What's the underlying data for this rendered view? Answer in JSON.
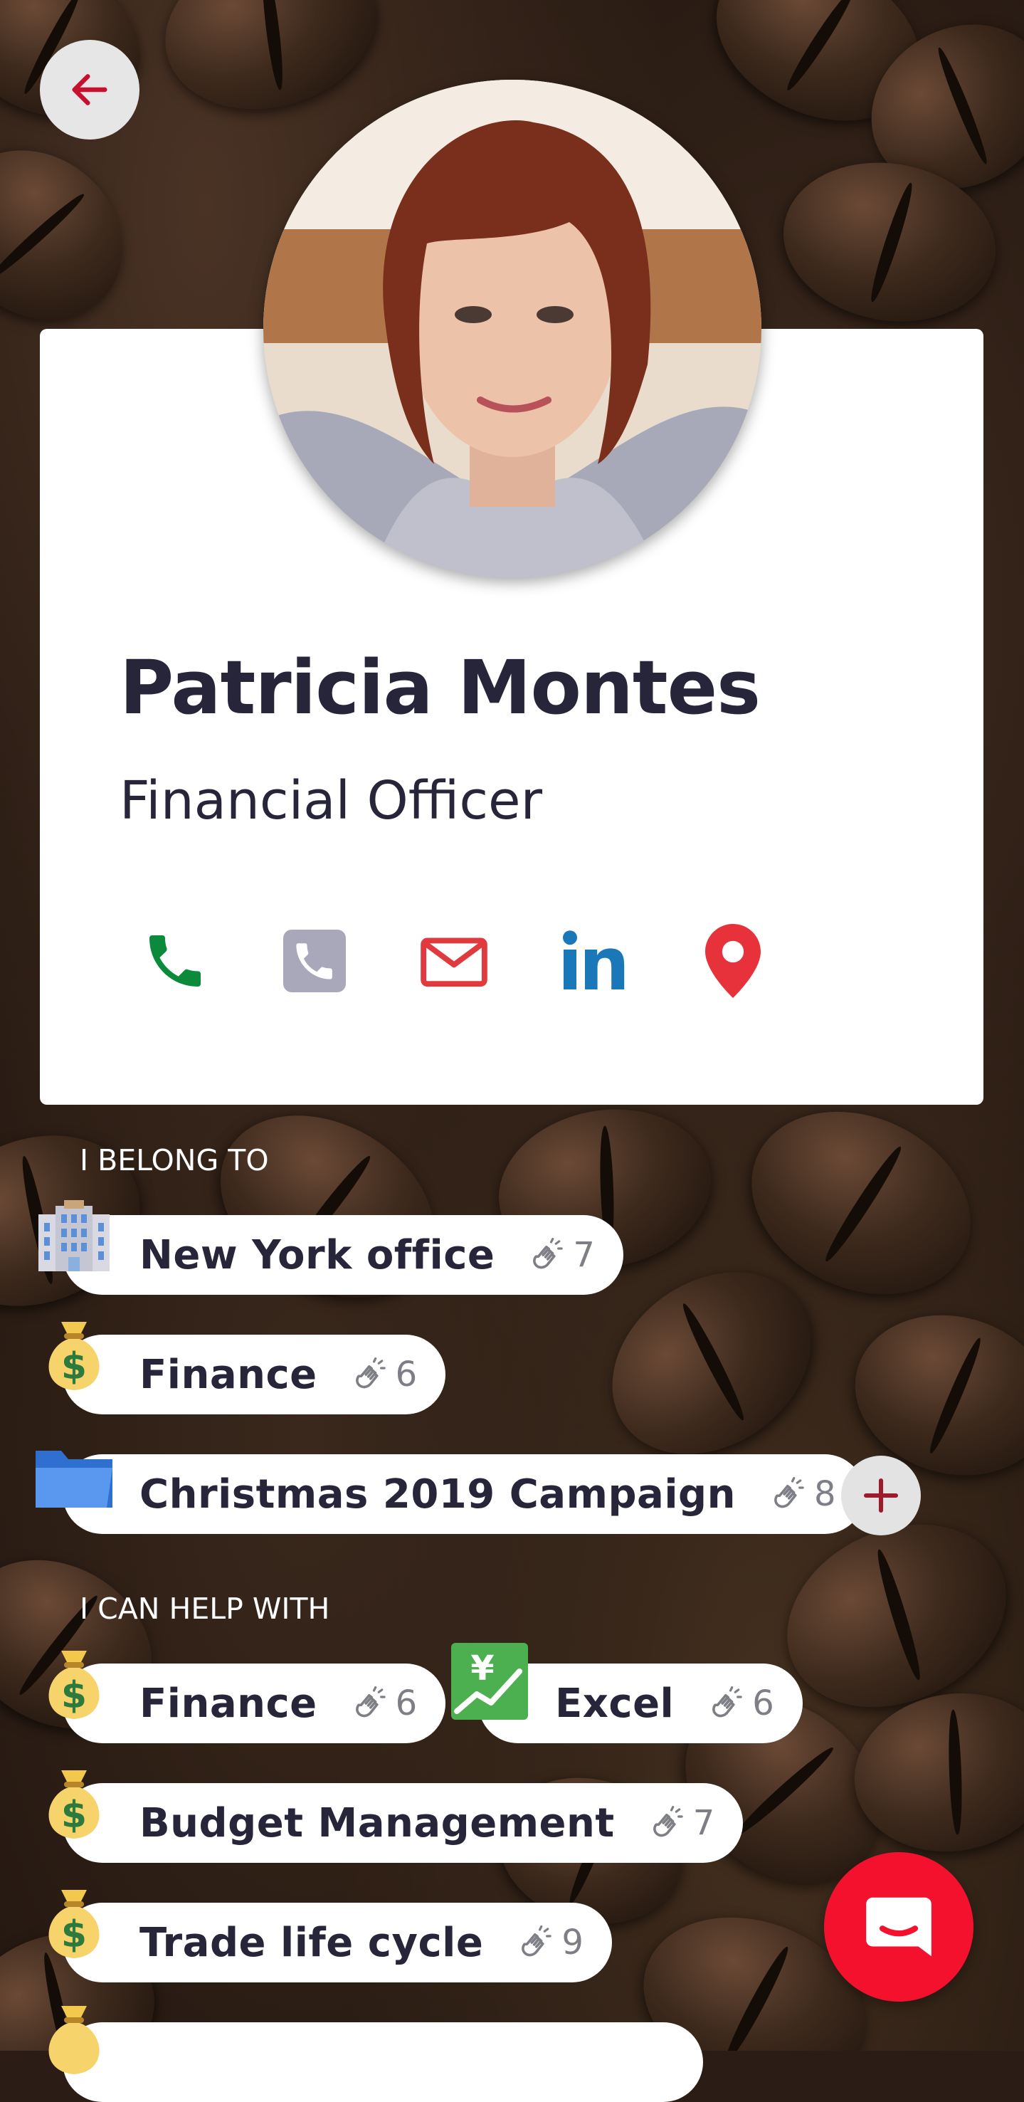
{
  "profile": {
    "name": "Patricia Montes",
    "title": "Financial Officer"
  },
  "contacts": [
    {
      "icon": "phone-icon",
      "color": "#0a8a3a"
    },
    {
      "icon": "landline-icon",
      "color": "#a9a8bb"
    },
    {
      "icon": "email-icon",
      "color": "#e03a3e"
    },
    {
      "icon": "linkedin-icon",
      "color": "#1a78b8"
    },
    {
      "icon": "location-pin-icon",
      "color": "#e8323b"
    }
  ],
  "sections": {
    "belong_to": "I BELONG TO",
    "help_with": "I CAN HELP WITH"
  },
  "groups": [
    {
      "label": "New York office",
      "count": "7",
      "icon": "office-building-icon"
    },
    {
      "label": "Finance",
      "count": "6",
      "icon": "money-bag-icon"
    },
    {
      "label": "Christmas 2019 Campaign",
      "count": "8",
      "icon": "folder-icon"
    }
  ],
  "skills": [
    {
      "label": "Finance",
      "count": "6",
      "icon": "money-bag-icon"
    },
    {
      "label": "Excel",
      "count": "6",
      "icon": "yen-chart-icon"
    },
    {
      "label": "Budget Management",
      "count": "7",
      "icon": "money-bag-icon"
    },
    {
      "label": "Trade life cycle",
      "count": "9",
      "icon": "money-bag-icon"
    }
  ],
  "colors": {
    "accent": "#f3112d",
    "back_arrow": "#c8102e",
    "text_dark": "#27253a"
  }
}
